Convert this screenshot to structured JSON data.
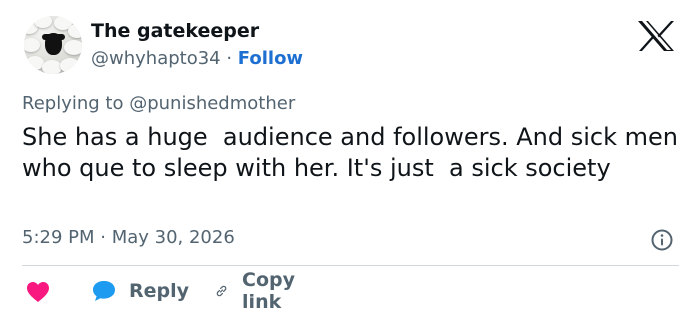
{
  "author": {
    "name": "The gatekeeper",
    "handle": "@whyhapto34",
    "separator": " · ",
    "follow_label": "Follow"
  },
  "reply_context": {
    "prefix": "Replying to ",
    "mention": "@punishedmother"
  },
  "tweet": {
    "text": "She has a huge  audience and followers. And sick men who que to sleep with her. It's just  a sick society",
    "timestamp": "5:29 PM · May 30, 2026"
  },
  "actions": {
    "reply_label": "Reply",
    "copy_link_label": "Copy link"
  },
  "icons": {
    "brand": "x-logo-icon",
    "info": "info-icon",
    "like": "heart-icon",
    "reply": "reply-bubble-icon",
    "copy": "link-icon"
  },
  "colors": {
    "heart": "#f91880",
    "reply_bubble": "#1d9bf0",
    "follow": "#1d6fd1",
    "muted": "#536471",
    "text": "#0f1419"
  }
}
